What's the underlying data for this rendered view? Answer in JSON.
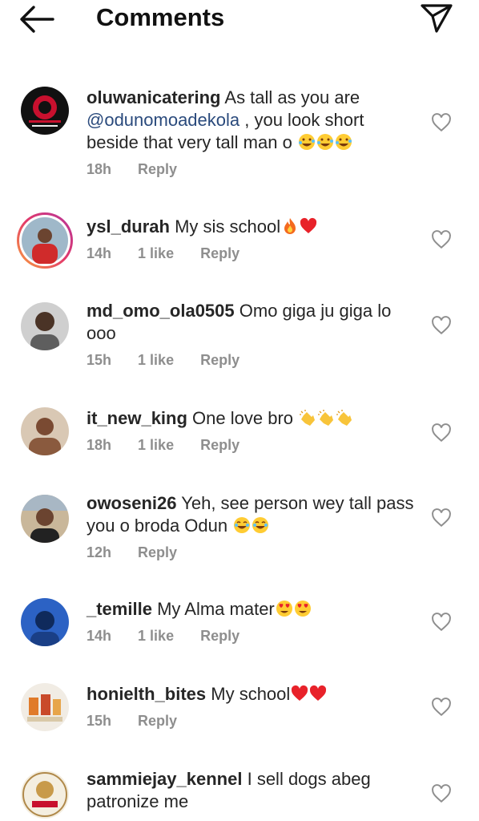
{
  "header": {
    "title": "Comments"
  },
  "comments": [
    {
      "username": "oluwanicatering",
      "text_before": "As tall as you are ",
      "mention": "@odunomoadekola",
      "text_after": " , you look short beside that very tall man o",
      "emojis": [
        "rofl",
        "rofl",
        "rofl"
      ],
      "time": "18h",
      "likes": "",
      "reply": "Reply"
    },
    {
      "username": "ysl_durah",
      "text": "My sis school",
      "emojis": [
        "fire",
        "heart"
      ],
      "time": "14h",
      "likes": "1 like",
      "reply": "Reply"
    },
    {
      "username": "md_omo_ola0505",
      "text": "Omo giga ju giga lo ooo",
      "emojis": [],
      "time": "15h",
      "likes": "1 like",
      "reply": "Reply"
    },
    {
      "username": "it_new_king",
      "text": "One love bro ",
      "emojis": [
        "clap",
        "clap",
        "clap"
      ],
      "time": "18h",
      "likes": "1 like",
      "reply": "Reply"
    },
    {
      "username": "owoseni26",
      "text": "Yeh, see person wey tall pass you o broda Odun ",
      "emojis": [
        "joy",
        "joy"
      ],
      "time": "12h",
      "likes": "",
      "reply": "Reply"
    },
    {
      "username": "_temille",
      "text": "My Alma mater",
      "emojis": [
        "hearteyes",
        "hearteyes"
      ],
      "time": "14h",
      "likes": "1 like",
      "reply": "Reply"
    },
    {
      "username": "honielth_bites",
      "text": "My school",
      "emojis": [
        "heart",
        "heart"
      ],
      "time": "15h",
      "likes": "",
      "reply": "Reply"
    },
    {
      "username": "sammiejay_kennel",
      "text": "I sell dogs abeg patronize me",
      "emojis": [],
      "time": "",
      "likes": "",
      "reply": ""
    }
  ],
  "colors": {
    "mention": "#2a4a7c",
    "meta": "#8e8e8e",
    "text": "#262626"
  }
}
